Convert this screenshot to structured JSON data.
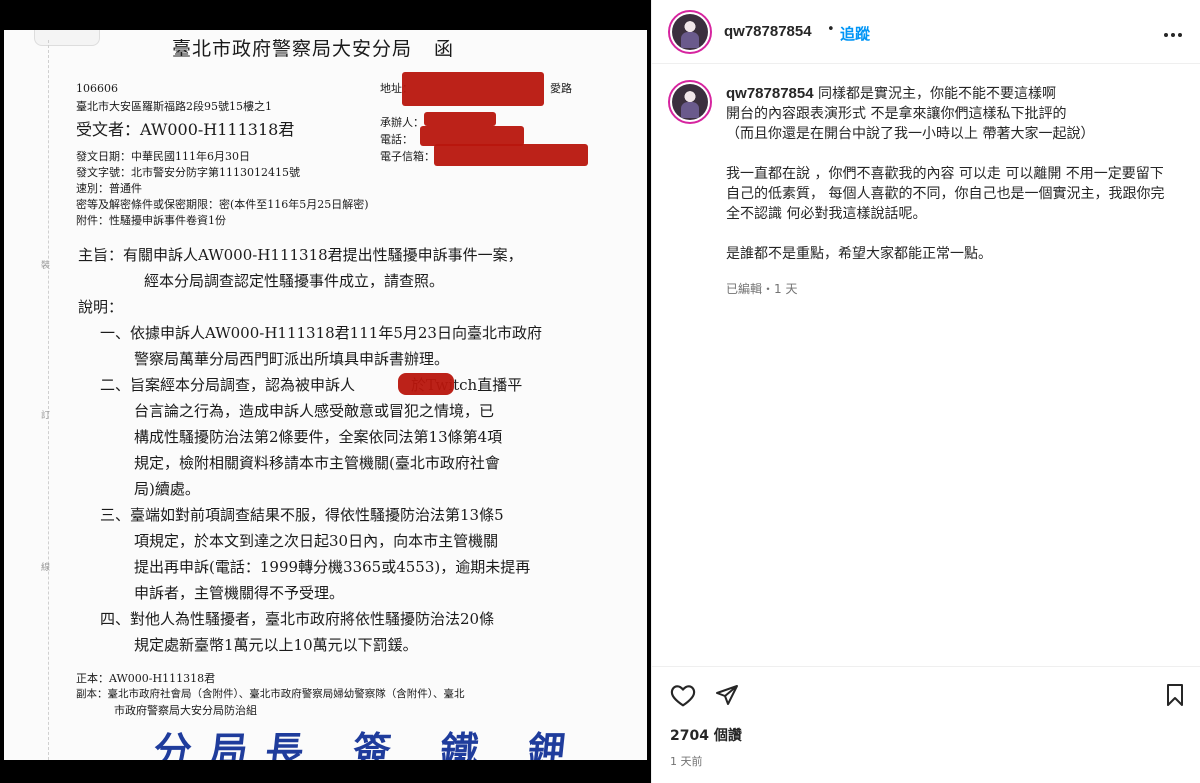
{
  "document": {
    "title": "臺北市政府警察局大安分局",
    "title_suffix": "函",
    "postal_code": "106606",
    "address": "臺北市大安區羅斯福路2段95號15樓之1",
    "recipient": "受文者：AW000-H111318君",
    "addr_label": "地址：",
    "addr_tail": "愛路",
    "contact_label": "承辦人：",
    "phone_label": "電話：",
    "email_label": "電子信箱：",
    "issue_date": "發文日期：中華民國111年6月30日",
    "issue_no": "發文字號：北市警安分防字第1113012415號",
    "speed": "速別：普通件",
    "secrecy": "密等及解密條件或保密期限：密(本件至116年5月25日解密)",
    "attachment": "附件：性騷擾申訴事件卷資1份",
    "subject_1": "主旨：有關申訴人AW000-H111318君提出性騷擾申訴事件一案，",
    "subject_2": "經本分局調查認定性騷擾事件成立，請查照。",
    "explain_label": "說明：",
    "p1_1": "一、依據申訴人AW000-H111318君111年5月23日向臺北市政府",
    "p1_2": "警察局萬華分局西門町派出所填具申訴書辦理。",
    "p2_1a": "二、旨案經本分局調查，認為被申訴人",
    "p2_1b": "於Twitch直播平",
    "p2_2": "台言論之行為，造成申訴人感受敵意或冒犯之情境，已",
    "p2_3": "構成性騷擾防治法第2條要件，全案依同法第13條第4項",
    "p2_4": "規定，檢附相關資料移請本市主管機關(臺北市政府社會",
    "p2_5": "局)續處。",
    "p3_1": "三、臺端如對前項調查結果不服，得依性騷擾防治法第13條5",
    "p3_2": "項規定，於本文到達之次日起30日內，向本市主管機關",
    "p3_3": "提出再申訴(電話：1999轉分機3365或4553)，逾期未提再",
    "p3_4": "申訴者，主管機關得不予受理。",
    "p4_1": "四、對他人為性騷擾者，臺北市政府將依性騷擾防治法20條",
    "p4_2": "規定處新臺幣1萬元以上10萬元以下罰鍰。",
    "original": "正本：AW000-H111318君",
    "copy_1": "副本：臺北市政府社會局（含附件）、臺北市政府警察局婦幼警察隊（含附件）、臺北",
    "copy_2": "市政府警察局大安分局防治組",
    "side_marks": [
      "裝",
      "訂",
      "線"
    ],
    "seal": "分局長 簽 鐵 鉀"
  },
  "post": {
    "username": "qw78787854",
    "separator": "•",
    "follow_label": "追蹤",
    "more_label": "•••",
    "caption": "同樣都是實況主，你能不能不要這樣啊\n開台的內容跟表演形式 不是拿來讓你們這樣私下批評的\n（而且你還是在開台中說了我一小時以上 帶著大家一起說）\n\n我一直都在說 ，你們不喜歡我的內容 可以走 可以離開 不用一定要留下自己的低素質， 每個人喜歡的不同，你自己也是一個實況主，我跟你完全不認識 何必對我這樣說話呢。\n\n是誰都不是重點，希望大家都能正常一點。",
    "edited_meta": "已編輯・1 天",
    "reads": "2704 個讚",
    "time_ago": "1 天前"
  },
  "colors": {
    "accent": "#0095f6",
    "redaction": "#b8160d",
    "seal_ink": "#1f3c9c"
  },
  "icons": [
    "heart-icon",
    "share-icon",
    "bookmark-icon",
    "more-icon"
  ]
}
